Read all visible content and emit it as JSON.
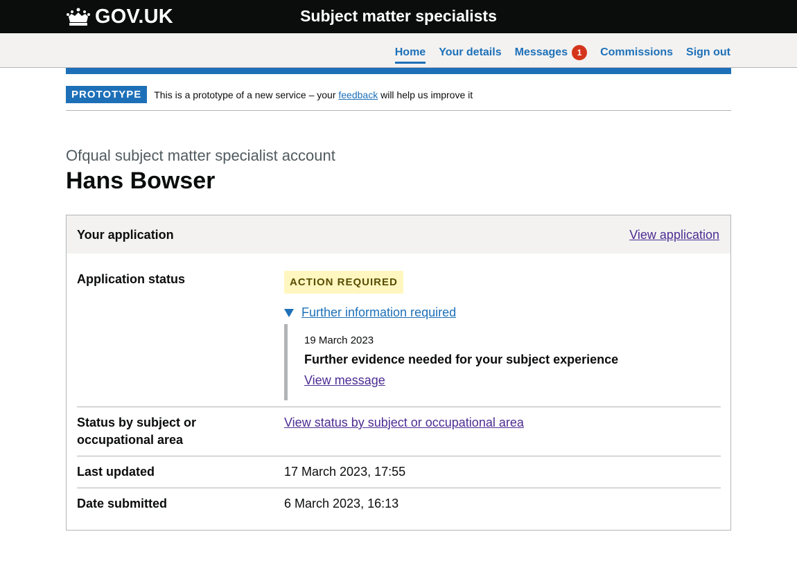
{
  "header": {
    "logo_text": "GOV.UK",
    "service_name": "Subject matter specialists"
  },
  "nav": {
    "items": [
      {
        "label": "Home",
        "active": true
      },
      {
        "label": "Your details",
        "active": false
      },
      {
        "label": "Messages",
        "active": false,
        "badge": "1"
      },
      {
        "label": "Commissions",
        "active": false
      },
      {
        "label": "Sign out",
        "active": false
      }
    ]
  },
  "phase": {
    "tag": "PROTOTYPE",
    "text_before": "This is a prototype of a new service – your",
    "link": "feedback",
    "text_after": "will help us improve it"
  },
  "page": {
    "caption": "Ofqual subject matter specialist account",
    "title": "Hans Bowser"
  },
  "card": {
    "title": "Your application",
    "link": "View application",
    "rows": [
      {
        "key": "Application status",
        "status_tag": "ACTION REQUIRED"
      },
      {
        "key": "Status by subject or occupational area",
        "value_link": "View status by subject or occupational area"
      },
      {
        "key": "Last updated",
        "value": "17 March 2023, 17:55"
      },
      {
        "key": "Date submitted",
        "value": "6 March 2023, 16:13"
      }
    ],
    "details": {
      "summary": "Further information required",
      "date": "19 March 2023",
      "title": "Further evidence needed for your subject experience",
      "link": "View message"
    }
  },
  "colors": {
    "header_bg": "#0b0c0c",
    "link_blue": "#1d70b8",
    "visited_purple": "#4c2c92",
    "badge_red": "#d4351c",
    "tag_yellow_bg": "#fff7bf",
    "tag_yellow_text": "#594d00"
  }
}
